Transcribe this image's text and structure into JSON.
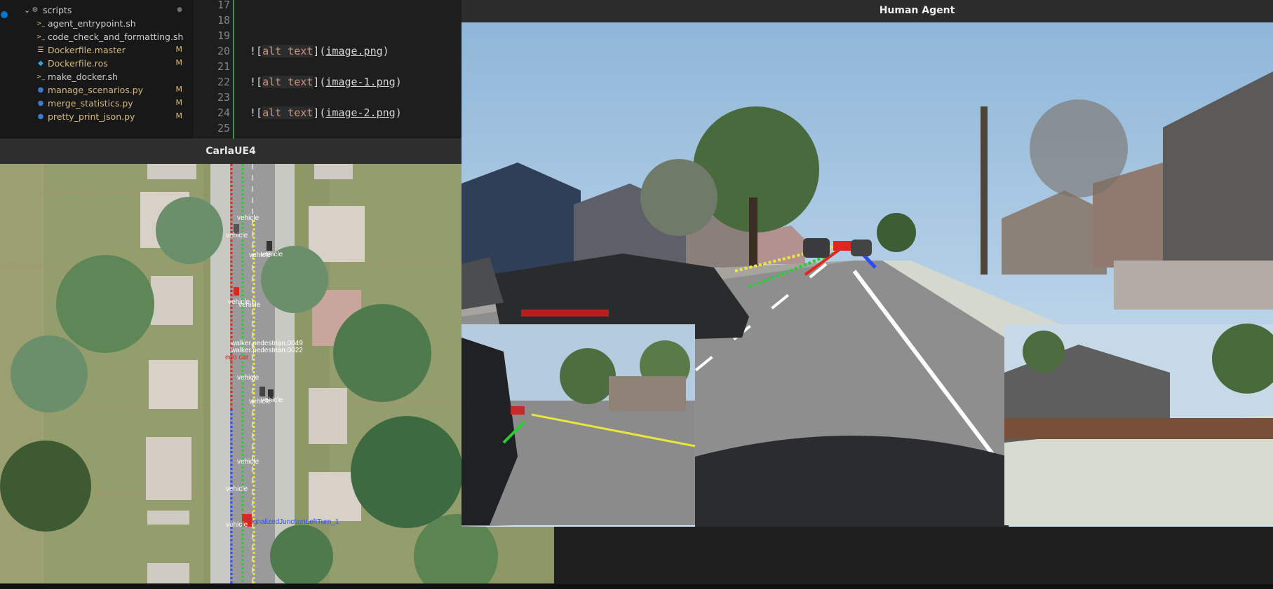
{
  "vscode": {
    "folder": {
      "name": "scripts",
      "badge": ""
    },
    "files": [
      {
        "name": "agent_entrypoint.sh",
        "icon": "shell-file-icon",
        "badge": ""
      },
      {
        "name": "code_check_and_formatting.sh",
        "icon": "shell-file-icon",
        "badge": ""
      },
      {
        "name": "Dockerfile.master",
        "icon": "dockerfile-icon",
        "badge": "M"
      },
      {
        "name": "Dockerfile.ros",
        "icon": "docker-whale-icon",
        "badge": "M"
      },
      {
        "name": "make_docker.sh",
        "icon": "shell-file-icon",
        "badge": ""
      },
      {
        "name": "manage_scenarios.py",
        "icon": "python-file-icon",
        "badge": "M"
      },
      {
        "name": "merge_statistics.py",
        "icon": "python-file-icon",
        "badge": "M"
      },
      {
        "name": "pretty_print_json.py",
        "icon": "python-file-icon",
        "badge": "M"
      }
    ],
    "lines": [
      {
        "num": "17",
        "pre": "",
        "lit": "",
        "mid": "",
        "link": "",
        "post": ""
      },
      {
        "num": "18",
        "pre": "",
        "lit": "",
        "mid": "",
        "link": "",
        "post": ""
      },
      {
        "num": "19",
        "pre": "",
        "lit": "",
        "mid": "",
        "link": "",
        "post": ""
      },
      {
        "num": "20",
        "pre": "![",
        "lit": "alt text",
        "mid": "](",
        "link": "image.png",
        "post": ")"
      },
      {
        "num": "21",
        "pre": "",
        "lit": "",
        "mid": "",
        "link": "",
        "post": ""
      },
      {
        "num": "22",
        "pre": "![",
        "lit": "alt text",
        "mid": "](",
        "link": "image-1.png",
        "post": ")"
      },
      {
        "num": "23",
        "pre": "",
        "lit": "",
        "mid": "",
        "link": "",
        "post": ""
      },
      {
        "num": "24",
        "pre": "![",
        "lit": "alt text",
        "mid": "](",
        "link": "image-2.png",
        "post": ")"
      },
      {
        "num": "25",
        "pre": "",
        "lit": "",
        "mid": "",
        "link": "",
        "post": ""
      }
    ]
  },
  "carla": {
    "title": "CarlaUE4",
    "labels": {
      "vehicle": "vehicle",
      "walker1": "walker.pedestrian.0049",
      "walker2": "walker.pedestrian.0022",
      "ego": "ego car",
      "route": "SignalizedJunctionLeftTurn_1"
    }
  },
  "agent": {
    "title": "Human Agent"
  },
  "colors": {
    "grass": "#8f9a6a",
    "road": "#9a9a9a",
    "sky": "#b9d6ee",
    "red_marker": "#e0261e",
    "green_marker": "#22d12e",
    "yellow_marker": "#e9e83a",
    "blue_marker": "#2a4bff",
    "modified_badge": "#d7ba7d"
  }
}
